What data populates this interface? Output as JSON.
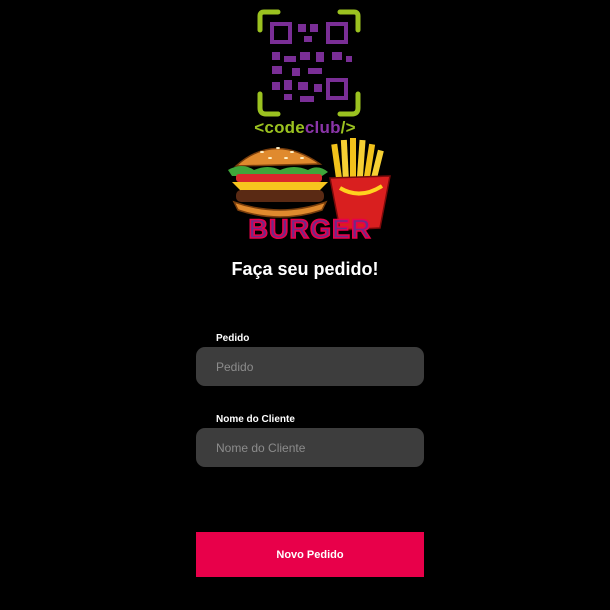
{
  "brand": {
    "lt": "<",
    "code": "code",
    "club": "club",
    "close": "/>",
    "burger_word": "BURGER",
    "colors": {
      "green": "#9bc220",
      "purple": "#8a35a8",
      "accent": "#e8004a"
    }
  },
  "form": {
    "title": "Faça seu pedido!",
    "fields": [
      {
        "label": "Pedido",
        "placeholder": "Pedido",
        "value": ""
      },
      {
        "label": "Nome do Cliente",
        "placeholder": "Nome do Cliente",
        "value": ""
      }
    ],
    "submit_label": "Novo Pedido"
  },
  "icons": [
    "qr-code-logo-icon",
    "burger-fries-illustration"
  ]
}
